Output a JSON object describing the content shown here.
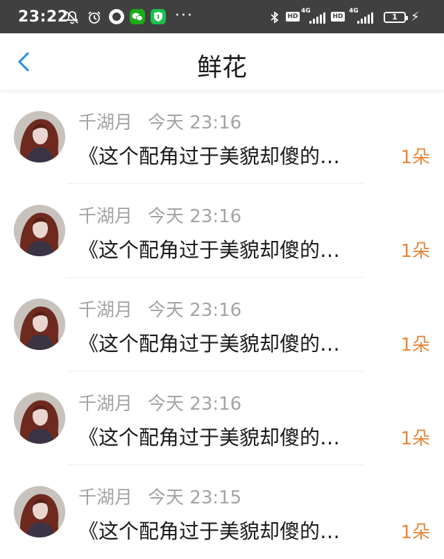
{
  "status_bar": {
    "time": "23:22",
    "network_1": "4G",
    "network_2": "4G",
    "hd_label": "HD",
    "battery": "1",
    "more_dots": "···",
    "colors": {
      "background": "#404040",
      "wechat": "#1aad19",
      "shield": "#19c34d"
    }
  },
  "header": {
    "title": "鲜花",
    "back_icon": "chevron-left-icon",
    "colors": {
      "back": "#2f8fe8"
    }
  },
  "items": [
    {
      "user": "千湖月",
      "time": "今天 23:16",
      "message": "《这个配角过于美貌却傻的…",
      "count": "1朵"
    },
    {
      "user": "千湖月",
      "time": "今天 23:16",
      "message": "《这个配角过于美貌却傻的…",
      "count": "1朵"
    },
    {
      "user": "千湖月",
      "time": "今天 23:16",
      "message": "《这个配角过于美貌却傻的…",
      "count": "1朵"
    },
    {
      "user": "千湖月",
      "time": "今天 23:16",
      "message": "《这个配角过于美貌却傻的…",
      "count": "1朵"
    },
    {
      "user": "千湖月",
      "time": "今天 23:15",
      "message": "《这个配角过于美貌却傻的…",
      "count": "1朵"
    }
  ],
  "colors": {
    "count_text": "#e8863b",
    "meta_text": "#a3a3a3",
    "message_text": "#1a1a1a"
  }
}
